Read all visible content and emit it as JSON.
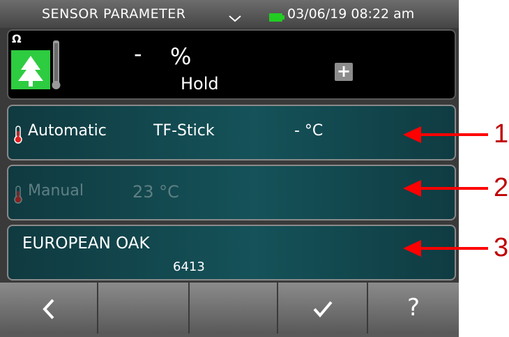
{
  "statusbar": {
    "title": "SENSOR PARAMETER",
    "datetime": "03/06/19 08:22 am",
    "battery_color": "#22cc22",
    "dropdown_icon": "chevron-down-icon"
  },
  "measurement": {
    "resistance_symbol": "Ω",
    "value": "-",
    "unit": "%",
    "status": "Hold",
    "plus_label": "+",
    "icon": "wood-thermometer-icon"
  },
  "rows": [
    {
      "mode": "Automatic",
      "sensor": "TF-Stick",
      "temperature": "- °C",
      "enabled": true
    },
    {
      "mode": "Manual",
      "temperature": "23 °C",
      "enabled": false
    },
    {
      "species": "EUROPEAN OAK",
      "code": "6413"
    }
  ],
  "softkeys": {
    "back": "‹",
    "key2": "",
    "key3": "",
    "confirm": "✓",
    "help": "?"
  },
  "callouts": [
    "1",
    "2",
    "3"
  ],
  "colors": {
    "accent_teal": "#155259",
    "callout_red": "#c00000"
  }
}
